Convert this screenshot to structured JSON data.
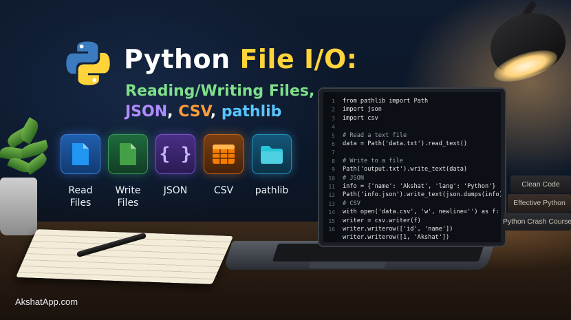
{
  "title": {
    "main_prefix": "Python ",
    "main_highlight": "File I/O:",
    "line2": "Reading/Writing Files,",
    "line3_json": "JSON",
    "line3_sep1": ", ",
    "line3_csv": "CSV",
    "line3_sep2": ", ",
    "line3_pathlib": "pathlib"
  },
  "tiles": [
    {
      "label_l1": "Read",
      "label_l2": "Files",
      "icon": "file-icon",
      "color": "#1e88e5"
    },
    {
      "label_l1": "Write",
      "label_l2": "Files",
      "icon": "file-icon",
      "color": "#43a047"
    },
    {
      "label_l1": "JSON",
      "label_l2": "",
      "icon": "braces-icon",
      "color": "#8e6bd8"
    },
    {
      "label_l1": "CSV",
      "label_l2": "",
      "icon": "table-icon",
      "color": "#f57c00"
    },
    {
      "label_l1": "pathlib",
      "label_l2": "",
      "icon": "folder-icon",
      "color": "#26c6da"
    }
  ],
  "code": {
    "line_numbers": [
      "1",
      "2",
      "3",
      "4",
      "5",
      "6",
      "7",
      "8",
      "9",
      "10",
      "11",
      "12",
      "13",
      "14",
      "15",
      "16"
    ],
    "lines": [
      "from pathlib import Path",
      "import json",
      "import csv",
      "",
      "# Read a text file",
      "data = Path('data.txt').read_text()",
      "",
      "# Write to a file",
      "Path('output.txt').write_text(data)",
      "# JSON",
      "info = {'name': 'Akshat', 'lang': 'Python'}",
      "Path('info.json').write_text(json.dumps(info))",
      "# CSV",
      "with open('data.csv', 'w', newline='') as f:",
      "    writer = csv.writer(f)",
      "    writer.writerow(['id', 'name'])",
      "    writer.writerow([1, 'Akshat'])"
    ]
  },
  "books": [
    "Clean Code",
    "Effective Python",
    "Python Crash Course"
  ],
  "watermark": "AkshatApp.com"
}
